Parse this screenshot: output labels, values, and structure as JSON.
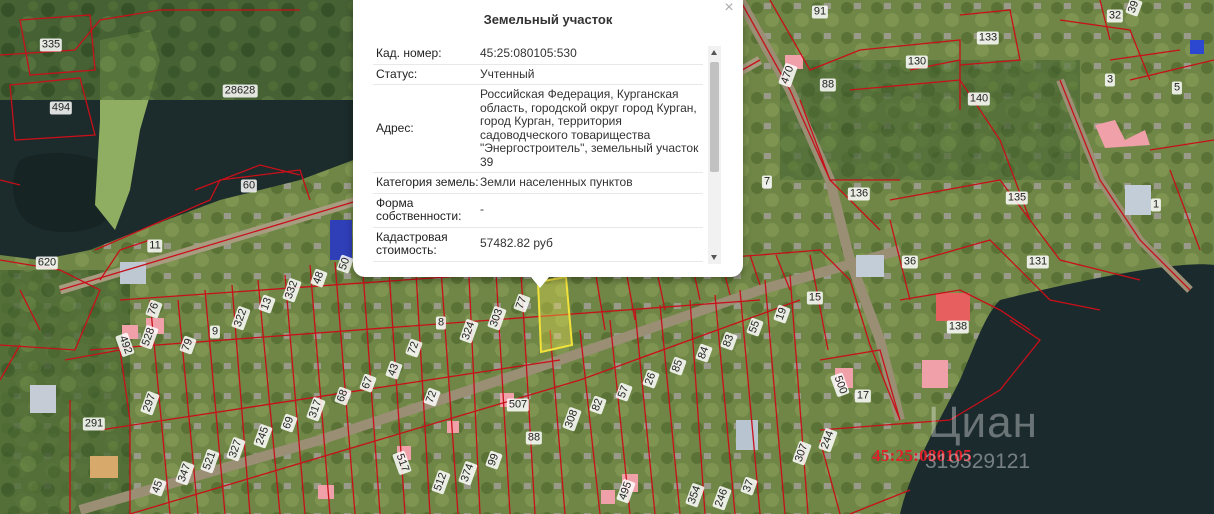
{
  "popup": {
    "title": "Земельный участок",
    "close_glyph": "×",
    "fields": [
      {
        "label": "Кад. номер:",
        "value": "45:25:080105:530"
      },
      {
        "label": "Статус:",
        "value": "Учтенный"
      },
      {
        "label": "Адрес:",
        "value": "Российская Федерация, Курганская область, городской округ город Курган, город Курган, территория садоводческого товарищества \"Энергостроитель\", земельный участок 39"
      },
      {
        "label": "Категория земель:",
        "value": "Земли населенных пунктов"
      },
      {
        "label": "Форма собственности:",
        "value": "-"
      },
      {
        "label": "Кадастровая стоимость:",
        "value": "57482.82 руб"
      }
    ]
  },
  "map": {
    "quarter_number": "45:25:080105",
    "watermark": "Циан",
    "watermark_id": "319329121",
    "plot_labels": [
      "335",
      "494",
      "28628",
      "60",
      "11",
      "620",
      "76",
      "528",
      "492",
      "79",
      "9",
      "322",
      "13",
      "332",
      "48",
      "50",
      "8",
      "324",
      "303",
      "77",
      "291",
      "297",
      "72",
      "67",
      "43",
      "72",
      "68",
      "317",
      "69",
      "245",
      "327",
      "521",
      "347",
      "45",
      "517",
      "512",
      "374",
      "99",
      "88",
      "507",
      "308",
      "82",
      "57",
      "26",
      "85",
      "84",
      "83",
      "55",
      "19",
      "15",
      "500",
      "17",
      "244",
      "307",
      "37",
      "246",
      "354",
      "495",
      "91",
      "470",
      "88",
      "130",
      "133",
      "140",
      "7",
      "136",
      "135",
      "36",
      "131",
      "138",
      "32",
      "39",
      "3",
      "5",
      "1"
    ]
  }
}
